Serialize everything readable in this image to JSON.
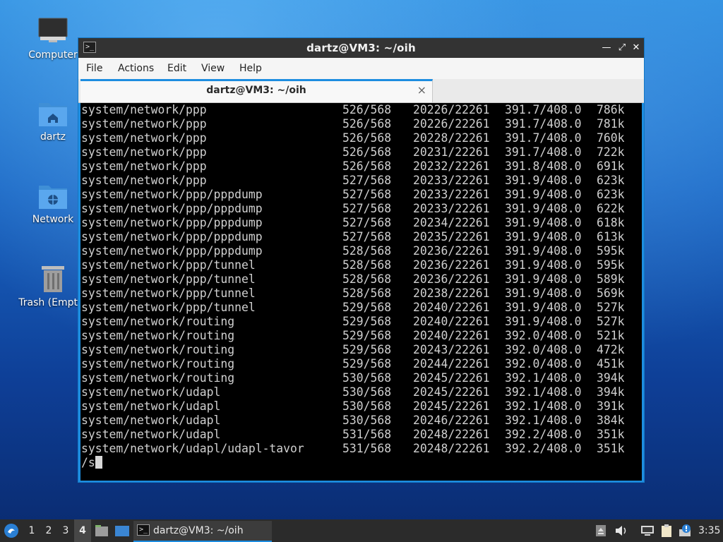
{
  "desktop": {
    "icons": [
      {
        "label": "Computer"
      },
      {
        "label": "dartz"
      },
      {
        "label": "Network"
      },
      {
        "label": "Trash (Empty)"
      }
    ]
  },
  "window": {
    "title": "dartz@VM3: ~/oih",
    "menu": [
      "File",
      "Actions",
      "Edit",
      "View",
      "Help"
    ],
    "tab_title": "dartz@VM3: ~/oih",
    "tab_close": "×"
  },
  "terminal": {
    "lines": [
      [
        "system/network/ppp",
        "526/568",
        "20226/22261",
        "391.7/408.0",
        "786k"
      ],
      [
        "system/network/ppp",
        "526/568",
        "20226/22261",
        "391.7/408.0",
        "781k"
      ],
      [
        "system/network/ppp",
        "526/568",
        "20228/22261",
        "391.7/408.0",
        "760k"
      ],
      [
        "system/network/ppp",
        "526/568",
        "20231/22261",
        "391.7/408.0",
        "722k"
      ],
      [
        "system/network/ppp",
        "526/568",
        "20232/22261",
        "391.8/408.0",
        "691k"
      ],
      [
        "system/network/ppp",
        "527/568",
        "20233/22261",
        "391.9/408.0",
        "623k"
      ],
      [
        "system/network/ppp/pppdump",
        "527/568",
        "20233/22261",
        "391.9/408.0",
        "623k"
      ],
      [
        "system/network/ppp/pppdump",
        "527/568",
        "20233/22261",
        "391.9/408.0",
        "622k"
      ],
      [
        "system/network/ppp/pppdump",
        "527/568",
        "20234/22261",
        "391.9/408.0",
        "618k"
      ],
      [
        "system/network/ppp/pppdump",
        "527/568",
        "20235/22261",
        "391.9/408.0",
        "613k"
      ],
      [
        "system/network/ppp/pppdump",
        "528/568",
        "20236/22261",
        "391.9/408.0",
        "595k"
      ],
      [
        "system/network/ppp/tunnel",
        "528/568",
        "20236/22261",
        "391.9/408.0",
        "595k"
      ],
      [
        "system/network/ppp/tunnel",
        "528/568",
        "20236/22261",
        "391.9/408.0",
        "589k"
      ],
      [
        "system/network/ppp/tunnel",
        "528/568",
        "20238/22261",
        "391.9/408.0",
        "569k"
      ],
      [
        "system/network/ppp/tunnel",
        "529/568",
        "20240/22261",
        "391.9/408.0",
        "527k"
      ],
      [
        "system/network/routing",
        "529/568",
        "20240/22261",
        "391.9/408.0",
        "527k"
      ],
      [
        "system/network/routing",
        "529/568",
        "20240/22261",
        "392.0/408.0",
        "521k"
      ],
      [
        "system/network/routing",
        "529/568",
        "20243/22261",
        "392.0/408.0",
        "472k"
      ],
      [
        "system/network/routing",
        "529/568",
        "20244/22261",
        "392.0/408.0",
        "451k"
      ],
      [
        "system/network/routing",
        "530/568",
        "20245/22261",
        "392.1/408.0",
        "394k"
      ],
      [
        "system/network/udapl",
        "530/568",
        "20245/22261",
        "392.1/408.0",
        "394k"
      ],
      [
        "system/network/udapl",
        "530/568",
        "20245/22261",
        "392.1/408.0",
        "391k"
      ],
      [
        "system/network/udapl",
        "530/568",
        "20246/22261",
        "392.1/408.0",
        "384k"
      ],
      [
        "system/network/udapl",
        "531/568",
        "20248/22261",
        "392.2/408.0",
        "351k"
      ],
      [
        "system/network/udapl/udapl-tavor",
        "531/568",
        "20248/22261",
        "392.2/408.0",
        "351k"
      ]
    ],
    "prompt": "/s"
  },
  "taskbar": {
    "workspaces": [
      "1",
      "2",
      "3",
      "4"
    ],
    "active_workspace": "4",
    "task_label": "dartz@VM3: ~/oih",
    "clock": "3:35"
  },
  "colors": {
    "accent": "#1d8de0",
    "titlebar": "#333333",
    "terminal_bg": "#000000",
    "terminal_fg": "#d0d0d0",
    "taskbar": "#2b2b2b"
  }
}
